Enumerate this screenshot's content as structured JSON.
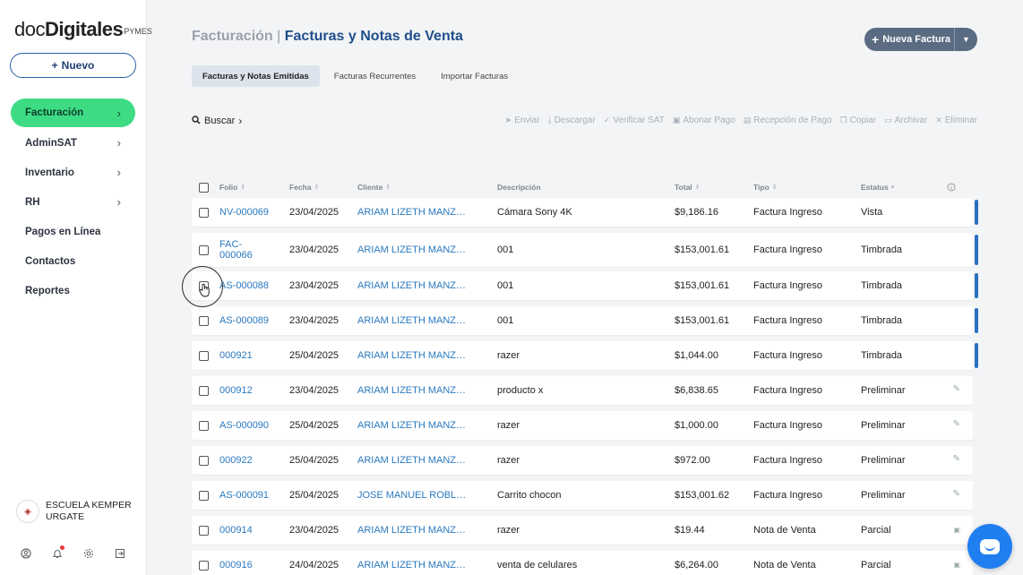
{
  "brand": {
    "doc": "doc",
    "digitales": "Digitales",
    "pymes": "PYMES"
  },
  "sidebar": {
    "new_button": "Nuevo",
    "items": [
      {
        "label": "Facturación",
        "chevron": true
      },
      {
        "label": "AdminSAT",
        "chevron": true
      },
      {
        "label": "Inventario",
        "chevron": true
      },
      {
        "label": "RH",
        "chevron": true
      },
      {
        "label": "Pagos en Línea",
        "chevron": false
      },
      {
        "label": "Contactos",
        "chevron": false
      },
      {
        "label": "Reportes",
        "chevron": false
      }
    ],
    "org_name": "ESCUELA KEMPER URGATE"
  },
  "header": {
    "crumb": "Facturación",
    "separator": "|",
    "title": "Facturas y Notas de Venta",
    "new_invoice": "Nueva Factura"
  },
  "tabs": [
    "Facturas y Notas Emitidas",
    "Facturas Recurrentes",
    "Importar Facturas"
  ],
  "search_label": "Buscar",
  "actions": [
    "Enviar",
    "Descargar",
    "Verificar SAT",
    "Abonar Pago",
    "Recepción de Pago",
    "Copiar",
    "Archivar",
    "Eliminar"
  ],
  "columns": {
    "folio": "Folio",
    "fecha": "Fecha",
    "cliente": "Cliente",
    "descripcion": "Descripción",
    "total": "Total",
    "tipo": "Tipo",
    "estatus": "Estatus"
  },
  "rows": [
    {
      "folio": "NV-000069",
      "fecha": "23/04/2025",
      "cliente": "ARIAM LIZETH MANZO…",
      "descripcion": "Cámara Sony 4K",
      "total": "$9,186.16",
      "tipo": "Factura Ingreso",
      "estatus": "Vista",
      "marker": "bar"
    },
    {
      "folio": "FAC-000066",
      "fecha": "23/04/2025",
      "cliente": "ARIAM LIZETH MANZO…",
      "descripcion": "001",
      "total": "$153,001.61",
      "tipo": "Factura Ingreso",
      "estatus": "Timbrada",
      "marker": "bar"
    },
    {
      "folio": "AS-000088",
      "fecha": "23/04/2025",
      "cliente": "ARIAM LIZETH MANZO…",
      "descripcion": "001",
      "total": "$153,001.61",
      "tipo": "Factura Ingreso",
      "estatus": "Timbrada",
      "marker": "bar"
    },
    {
      "folio": "AS-000089",
      "fecha": "23/04/2025",
      "cliente": "ARIAM LIZETH MANZO…",
      "descripcion": "001",
      "total": "$153,001.61",
      "tipo": "Factura Ingreso",
      "estatus": "Timbrada",
      "marker": "bar"
    },
    {
      "folio": "000921",
      "fecha": "25/04/2025",
      "cliente": "ARIAM LIZETH MANZO…",
      "descripcion": "razer",
      "total": "$1,044.00",
      "tipo": "Factura Ingreso",
      "estatus": "Timbrada",
      "marker": "bar"
    },
    {
      "folio": "000912",
      "fecha": "23/04/2025",
      "cliente": "ARIAM LIZETH MANZO…",
      "descripcion": "producto x",
      "total": "$6,838.65",
      "tipo": "Factura Ingreso",
      "estatus": "Preliminar",
      "marker": "edit"
    },
    {
      "folio": "AS-000090",
      "fecha": "25/04/2025",
      "cliente": "ARIAM LIZETH MANZO…",
      "descripcion": "razer",
      "total": "$1,000.00",
      "tipo": "Factura Ingreso",
      "estatus": "Preliminar",
      "marker": "edit"
    },
    {
      "folio": "000922",
      "fecha": "25/04/2025",
      "cliente": "ARIAM LIZETH MANZO…",
      "descripcion": "razer",
      "total": "$972.00",
      "tipo": "Factura Ingreso",
      "estatus": "Preliminar",
      "marker": "edit"
    },
    {
      "folio": "AS-000091",
      "fecha": "25/04/2025",
      "cliente": "JOSE MANUEL ROBLES…",
      "descripcion": "Carrito chocon",
      "total": "$153,001.62",
      "tipo": "Factura Ingreso",
      "estatus": "Preliminar",
      "marker": "edit"
    },
    {
      "folio": "000914",
      "fecha": "23/04/2025",
      "cliente": "ARIAM LIZETH MANZO…",
      "descripcion": "razer",
      "total": "$19.44",
      "tipo": "Nota de Venta",
      "estatus": "Parcial",
      "marker": "money"
    },
    {
      "folio": "000916",
      "fecha": "24/04/2025",
      "cliente": "ARIAM LIZETH MANZO…",
      "descripcion": "venta de celulares",
      "total": "$6,264.00",
      "tipo": "Nota de Venta",
      "estatus": "Parcial",
      "marker": "money"
    }
  ]
}
